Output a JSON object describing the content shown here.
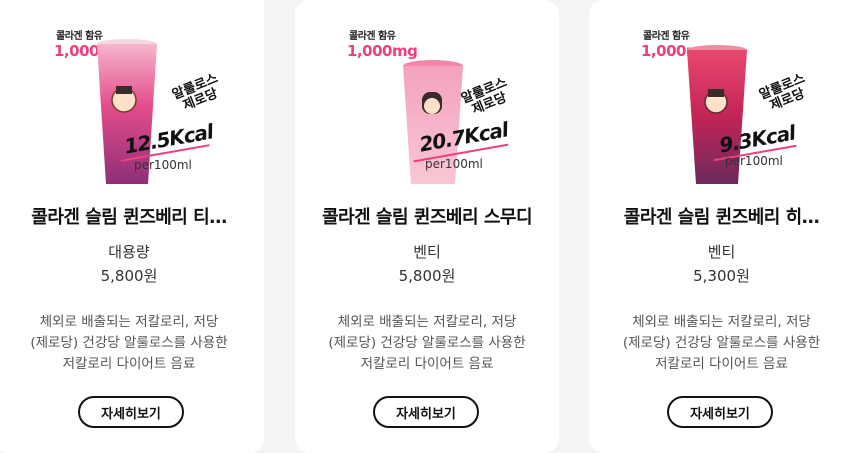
{
  "products": [
    {
      "badge_top": "콜라겐 함유",
      "badge_mg": "1,000mg",
      "sugar": "알룰로스\n제로당",
      "kcal": "12.5Kcal",
      "per": "per100ml",
      "name": "콜라겐 슬림 퀸즈베리 티…",
      "size": "대용량",
      "price": "5,800원",
      "desc": "체외로 배출되는 저칼로리, 저당\n(제로당) 건강당 알룰로스를 사용한\n저칼로리 다이어트 음료",
      "button": "자세히보기",
      "cup_color": "#d93a7e"
    },
    {
      "badge_top": "콜라겐 함유",
      "badge_mg": "1,000mg",
      "sugar": "알룰로스\n제로당",
      "kcal": "20.7Kcal",
      "per": "per100ml",
      "name": "콜라겐 슬림 퀸즈베리 스무디",
      "size": "벤티",
      "price": "5,800원",
      "desc": "체외로 배출되는 저칼로리, 저당\n(제로당) 건강당 알룰로스를 사용한\n저칼로리 다이어트 음료",
      "button": "자세히보기",
      "cup_color": "#f07ea0"
    },
    {
      "badge_top": "콜라겐 함유",
      "badge_mg": "1,000mg",
      "sugar": "알룰로스\n제로당",
      "kcal": "9.3Kcal",
      "per": "per100ml",
      "name": "콜라겐 슬림 퀸즈베리 히…",
      "size": "벤티",
      "price": "5,300원",
      "desc": "체외로 배출되는 저칼로리, 저당\n(제로당) 건강당 알룰로스를 사용한\n저칼로리 다이어트 음료",
      "button": "자세히보기",
      "cup_color": "#c22456"
    }
  ]
}
